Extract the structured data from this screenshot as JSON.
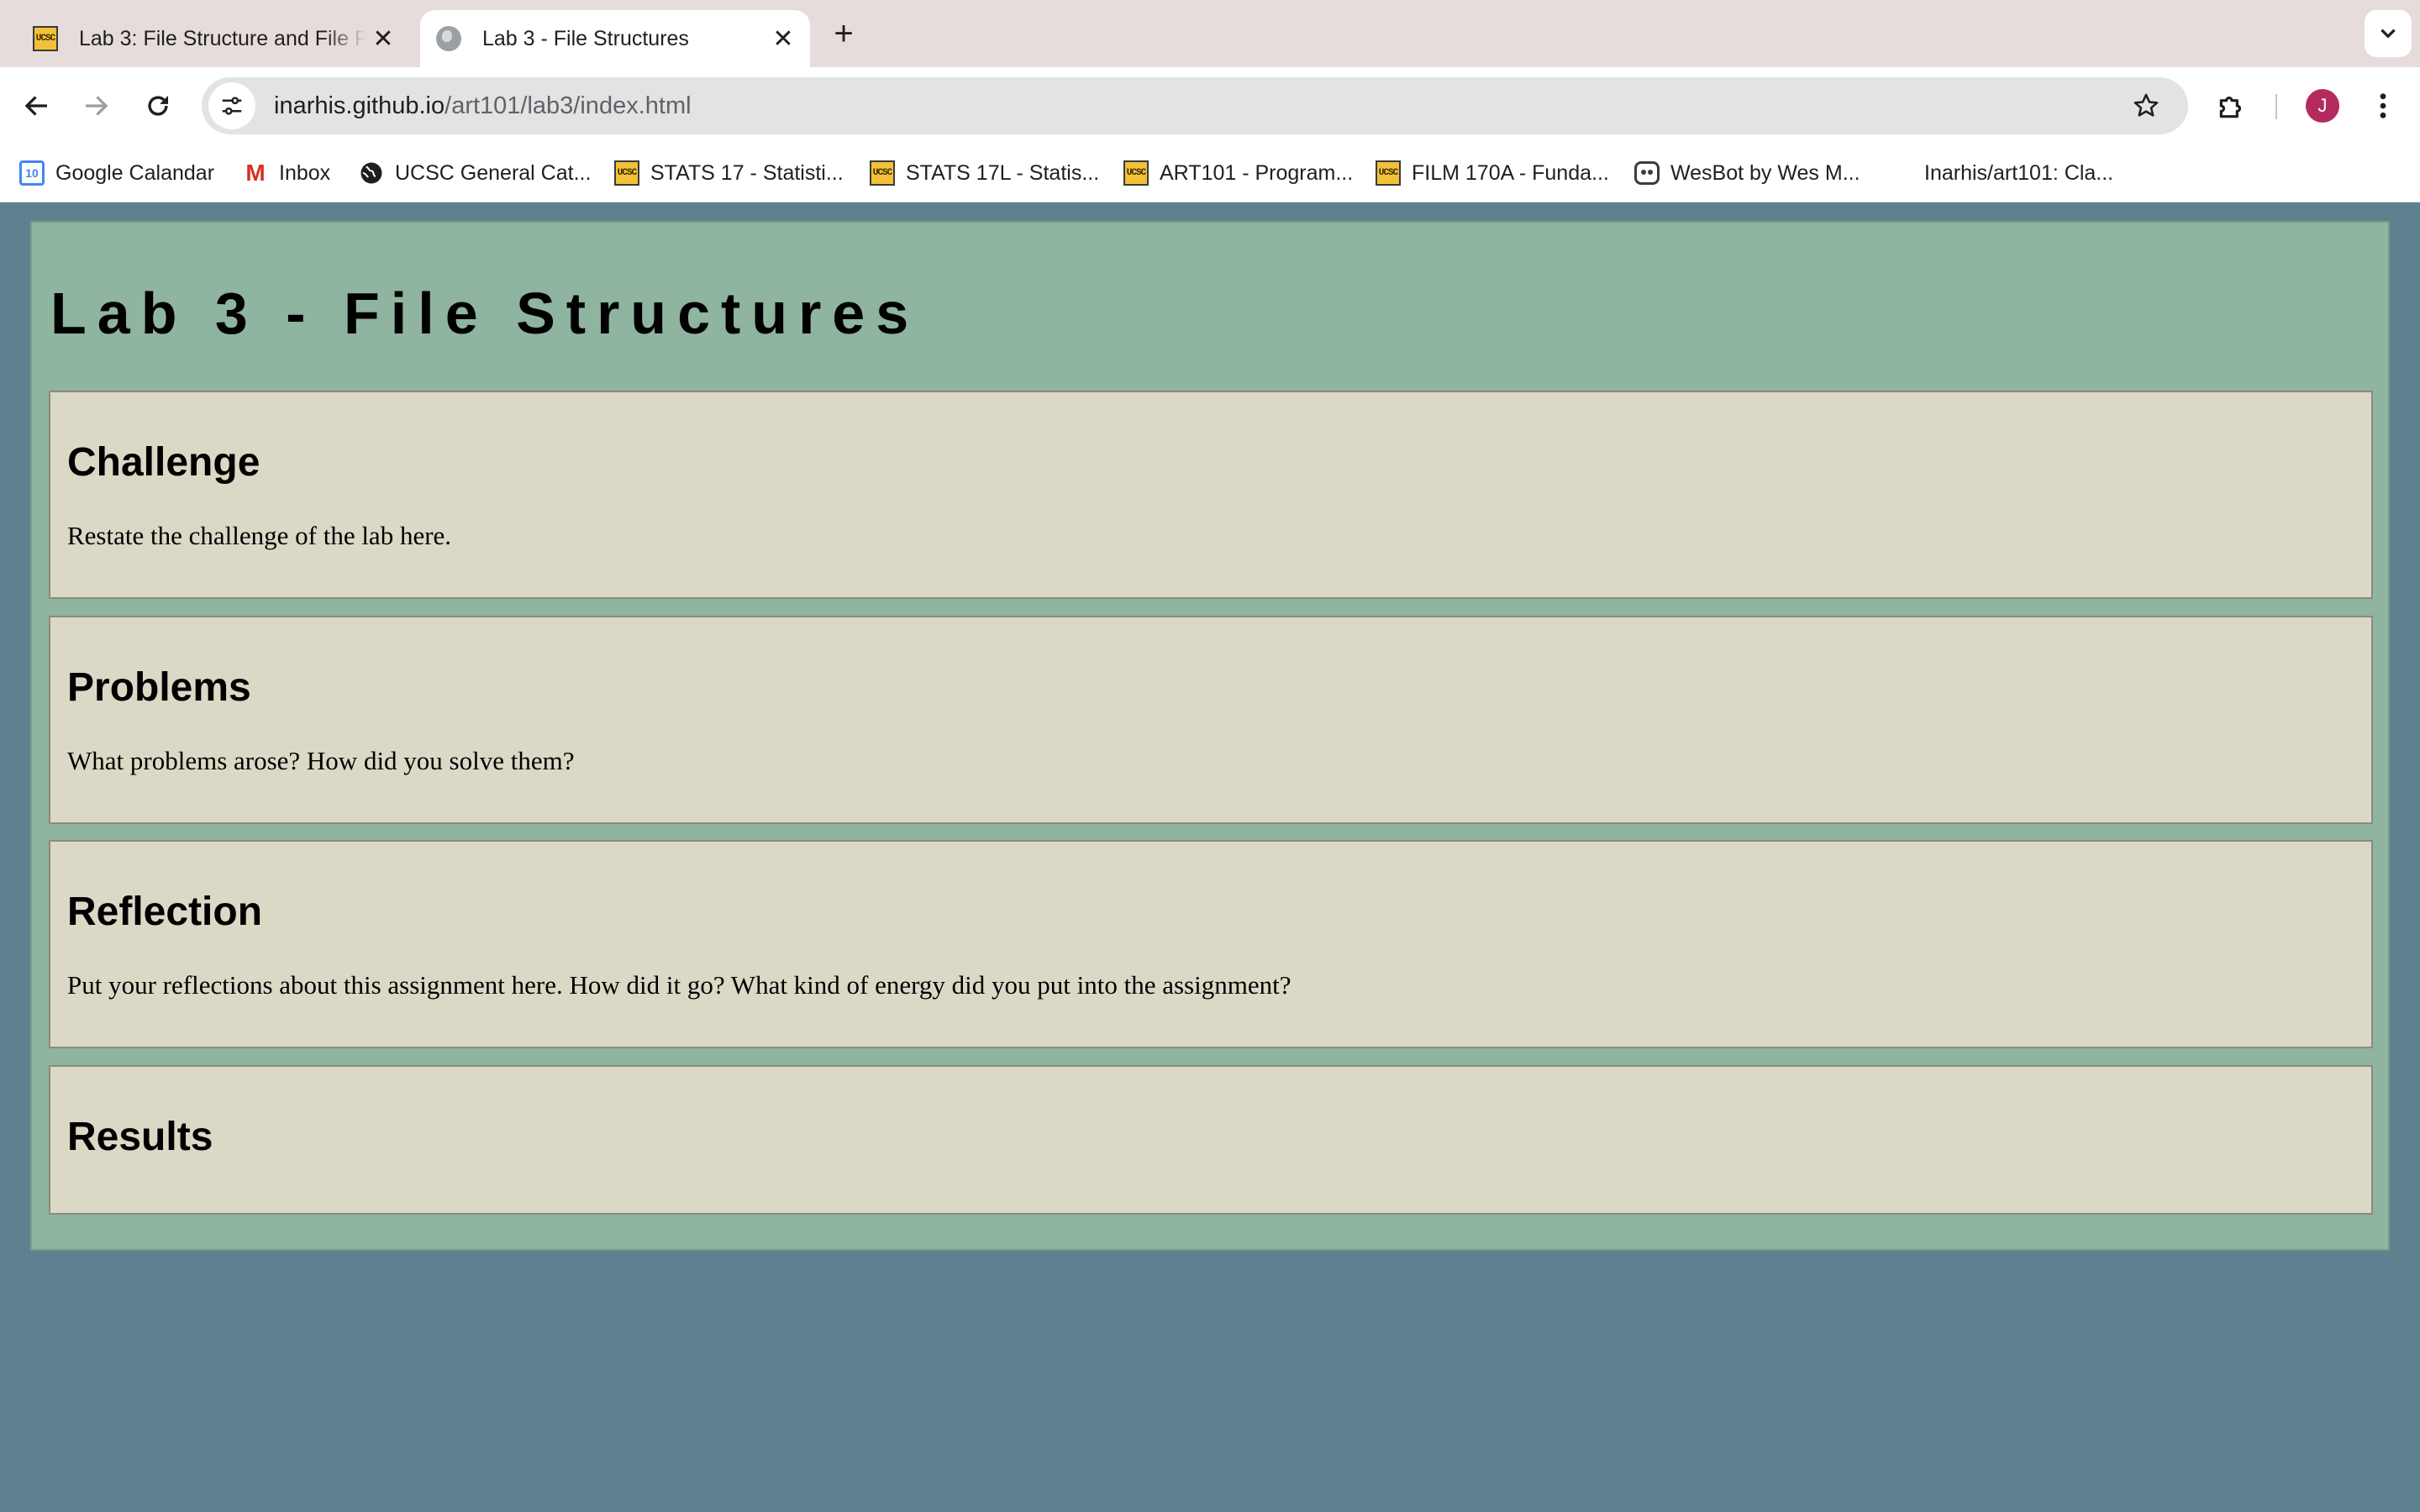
{
  "browser": {
    "tabs": [
      {
        "title": "Lab 3: File Structure and File Paths",
        "favicon": "ucsc-icon",
        "active": false
      },
      {
        "title": "Lab 3 - File Structures",
        "favicon": "globe-icon",
        "active": true
      }
    ],
    "address": {
      "host": "inarhis.github.io",
      "path": "/art101/lab3/index.html"
    },
    "profile_initial": "J",
    "bookmarks": [
      {
        "label": "Google Calandar",
        "icon": "calendar-icon"
      },
      {
        "label": "Inbox",
        "icon": "gmail-icon"
      },
      {
        "label": "UCSC General Cat...",
        "icon": "globe-icon"
      },
      {
        "label": "STATS 17 - Statisti...",
        "icon": "ucsc-icon"
      },
      {
        "label": "STATS 17L - Statis...",
        "icon": "ucsc-icon"
      },
      {
        "label": "ART101 - Program...",
        "icon": "ucsc-icon"
      },
      {
        "label": "FILM 170A - Funda...",
        "icon": "ucsc-icon"
      },
      {
        "label": "WesBot by Wes M...",
        "icon": "robot-icon"
      },
      {
        "label": "Inarhis/art101: Cla...",
        "icon": "github-icon"
      }
    ],
    "ucsc_favicon_text": "UCSC",
    "calendar_icon_text": "10",
    "colors": {
      "tabstrip": "#e6dcdc",
      "omnibox": "#e3e3e3",
      "avatar": "#b52a5e"
    }
  },
  "page": {
    "title": "Lab 3 - File Structures",
    "sections": [
      {
        "heading": "Challenge",
        "body": "Restate the challenge of the lab here."
      },
      {
        "heading": "Problems",
        "body": "What problems arose? How did you solve them?"
      },
      {
        "heading": "Reflection",
        "body": "Put your reflections about this assignment here. How did it go? What kind of energy did you put into the assignment?"
      },
      {
        "heading": "Results",
        "body": ""
      }
    ],
    "colors": {
      "background": "#5e818f",
      "main": "#8fb49f",
      "section": "#dcd8c6"
    }
  }
}
